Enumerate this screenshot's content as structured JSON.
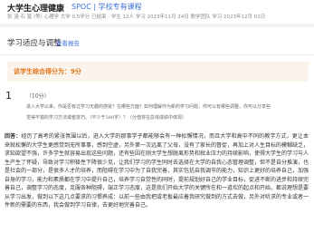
{
  "header": {
    "course_title": "大学生心理健康",
    "course_tag": "SPOC | 学校专有课程",
    "meta": "张 涵   石 猛 (等)   心理学   大学   0.5学分   已结束 · 学生   12人   学习   2023年11月   24日   教学团队   学习   2023年12月   02日"
  },
  "main": {
    "title": "学习适应与调整",
    "view_report": "查看报告",
    "score_text": "该学生综合得分为：9分",
    "question": {
      "number": "1",
      "points": "（10分）",
      "line1": "进入大学以来，你是否有过学习无趣的感受？在哪些方面？如何理解作为新的学习问题，你可以有哪些调整，你可以分享些",
      "line2": "觉得不错的学习方法或者技巧。（不少于300字）？（分值将在总体成绩中体现）"
    },
    "answer_label": "回答：",
    "answer_text": "经历了高考的紧张氛围以后，进入大学的那事学子都能够会有一种松懈情况，而且大学和高中不同的教学方式，更让本来就松懈的大学生更感觉到无所事事，感到空虚，另外第一次远离了父母，没有了家长的督促，再加上对人生目标的模糊缺乏，求知欲望不强，许多学生就容易出现这些问题，还有些因在刚大学生想脱离形势和就业压力的持续影响，使得大学生的学习与人生产生了怀疑，导致对学习积极性下降很少见，让我们学习的学生同时去选择在大学的自我心态管理调整，但不是自分推演，也是社会的一部分，是很多人才的培养，而阻碍在学习中为了自我完善，其实包括自我调节的能力，知识上更好的培养自己，加强自身的学习，能力和素质都在学习中提升自己，培养学习自觉性的同时，提前规划好自己的学业目标，促进不断的进步和持续完善自己，调整学习的态度，克服各种阻碍，端正学习态度，这是我们开始大学的关键所在和一道坎的起点和开始，都说理想是要从学习出发，做到以下这几点要求的习惯养成：以前一些由我把或老板最应着我研究做到的方式去做，另外对听求的专业或者一件新的需要的东西，我会做到学习自律，去更好地完善自己。"
  }
}
